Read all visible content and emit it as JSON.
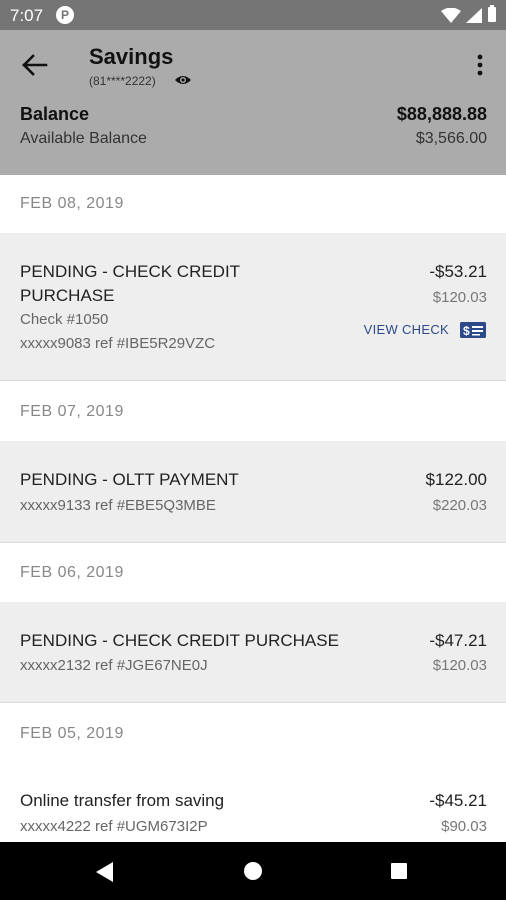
{
  "status_bar": {
    "time": "7:07",
    "app_badge": "P"
  },
  "header": {
    "title": "Savings",
    "account_number": "(81****2222)",
    "balance_label": "Balance",
    "balance_value": "$88,888.88",
    "available_label": "Available Balance",
    "available_value": "$3,566.00"
  },
  "dates": [
    "FEB 08, 2019",
    "FEB 07, 2019",
    "FEB 06, 2019",
    "FEB 05, 2019"
  ],
  "transactions": [
    {
      "desc_line1": "PENDING - CHECK CREDIT",
      "desc_line2": "PURCHASE",
      "check": "Check #1050",
      "ref": "xxxxx9083 ref #IBE5R29VZC",
      "amount": "-$53.21",
      "balance": "$120.03",
      "view_check_label": "VIEW CHECK"
    },
    {
      "desc": "PENDING - OLTT PAYMENT",
      "ref": "xxxxx9133 ref #EBE5Q3MBE",
      "amount": "$122.00",
      "balance": "$220.03"
    },
    {
      "desc": "PENDING - CHECK CREDIT PURCHASE",
      "ref": "xxxxx2132 ref #JGE67NE0J",
      "amount": "-$47.21",
      "balance": "$120.03"
    },
    {
      "desc": "Online transfer from saving",
      "ref": "xxxxx4222 ref #UGM673I2P",
      "amount": "-$45.21",
      "balance": "$90.03"
    }
  ],
  "colors": {
    "header_bg": "#ababab",
    "status_bar_bg": "#757575",
    "link": "#2c4a8a"
  }
}
